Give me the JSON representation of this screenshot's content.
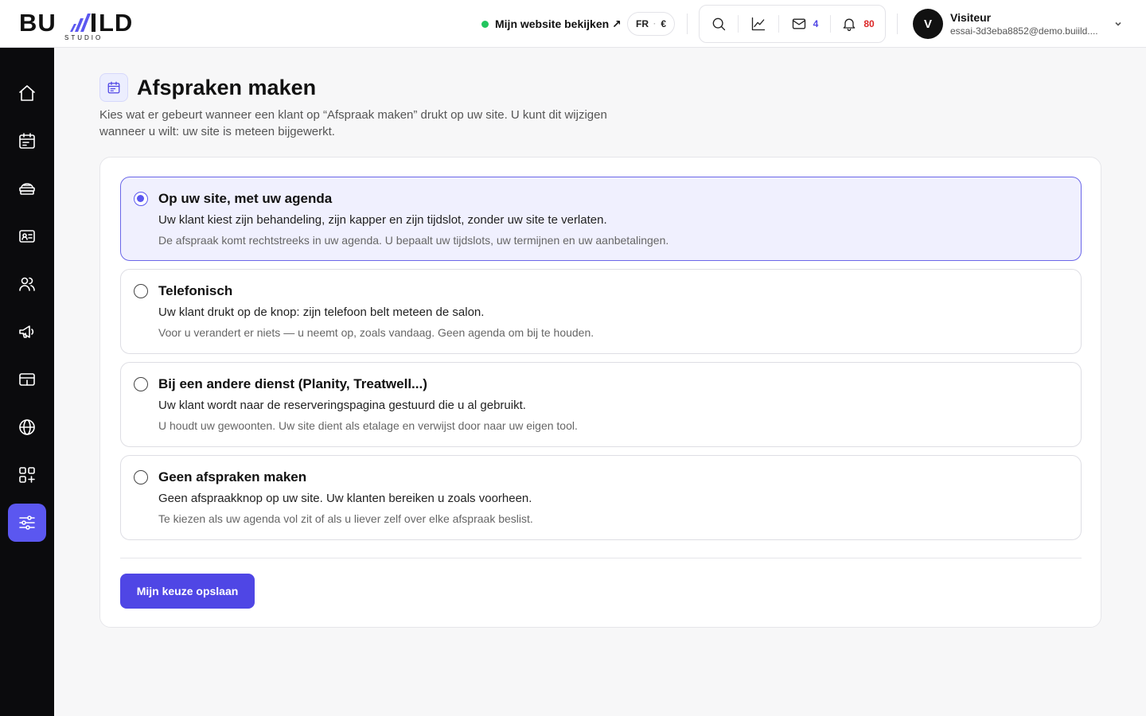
{
  "brand": {
    "name": "BUILLD",
    "sub": "STUDIO"
  },
  "header": {
    "site_link": "Mijn website bekijken ↗",
    "lang": "FR",
    "currency": "€",
    "mail_count": "4",
    "notif_count": "80",
    "user_initial": "V",
    "user_name": "Visiteur",
    "user_email": "essai-3d3eba8852@demo.buiild...."
  },
  "sidebar": {
    "items": [
      {
        "name": "home-icon",
        "active": false
      },
      {
        "name": "calendar-icon",
        "active": false
      },
      {
        "name": "services-icon",
        "active": false
      },
      {
        "name": "contact-card-icon",
        "active": false
      },
      {
        "name": "users-icon",
        "active": false
      },
      {
        "name": "megaphone-icon",
        "active": false
      },
      {
        "name": "payment-icon",
        "active": false
      },
      {
        "name": "globe-icon",
        "active": false
      },
      {
        "name": "apps-icon",
        "active": false
      },
      {
        "name": "settings-sliders-icon",
        "active": true
      }
    ]
  },
  "page": {
    "title": "Afspraken maken",
    "description": "Kies wat er gebeurt wanneer een klant op “Afspraak maken” drukt op uw site. U kunt dit wijzigen wanneer u wilt: uw site is meteen bijgewerkt."
  },
  "options": [
    {
      "title": "Op uw site, met uw agenda",
      "main": "Uw klant kiest zijn behandeling, zijn kapper en zijn tijdslot, zonder uw site te verlaten.",
      "sub": "De afspraak komt rechtstreeks in uw agenda. U bepaalt uw tijdslots, uw termijnen en uw aanbetalingen.",
      "selected": true
    },
    {
      "title": "Telefonisch",
      "main": "Uw klant drukt op de knop: zijn telefoon belt meteen de salon.",
      "sub": "Voor u verandert er niets — u neemt op, zoals vandaag. Geen agenda om bij te houden.",
      "selected": false
    },
    {
      "title": "Bij een andere dienst (Planity, Treatwell...)",
      "main": "Uw klant wordt naar de reserveringspagina gestuurd die u al gebruikt.",
      "sub": "U houdt uw gewoonten. Uw site dient als etalage en verwijst door naar uw eigen tool.",
      "selected": false
    },
    {
      "title": "Geen afspraken maken",
      "main": "Geen afspraakknop op uw site. Uw klanten bereiken u zoals voorheen.",
      "sub": "Te kiezen als uw agenda vol zit of als u liever zelf over elke afspraak beslist.",
      "selected": false
    }
  ],
  "save_label": "Mijn keuze opslaan",
  "colors": {
    "accent": "#4f46e5",
    "sidebar": "#0b0b0d",
    "selected_bg": "#f0f0fe",
    "online": "#22c55e",
    "alert": "#dc2626"
  }
}
